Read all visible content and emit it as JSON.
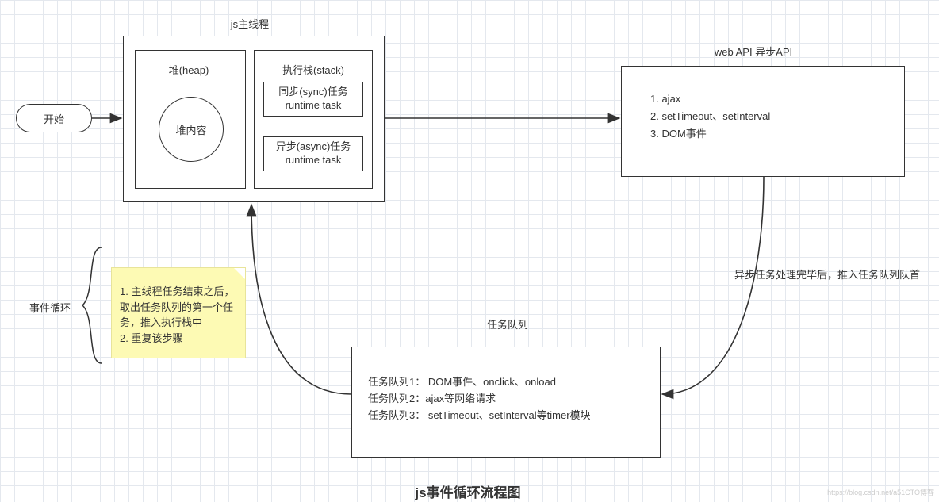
{
  "start": {
    "label": "开始"
  },
  "mainthread": {
    "title": "js主线程"
  },
  "heap": {
    "title": "堆(heap)",
    "content": "堆内容"
  },
  "stack": {
    "title": "执行栈(stack)",
    "sync": "同步(sync)任务\nruntime task",
    "async": "异步(async)任务\nruntime task"
  },
  "webapi": {
    "title": "web API  异步API",
    "items": [
      "1. ajax",
      "2. setTimeout、setInterval",
      "3. DOM事件"
    ]
  },
  "taskqueue": {
    "title": "任务队列",
    "lines": [
      "任务队列1：  DOM事件、onclick、onload",
      "任务队列2：ajax等网络请求",
      "任务队列3：  setTimeout、setInterval等timer模块"
    ]
  },
  "note": {
    "lines": [
      "1. 主线程任务结束之后，取出任务队列的第一个任务，推入执行栈中",
      "2. 重复该步骤"
    ]
  },
  "eventloop": {
    "label": "事件循环"
  },
  "edges": {
    "async_done": "异步任务处理完毕后，推入任务队列队首"
  },
  "footer": {
    "title": "js事件循环流程图"
  },
  "watermark": "https://blog.csdn.net/a51CTO博客"
}
